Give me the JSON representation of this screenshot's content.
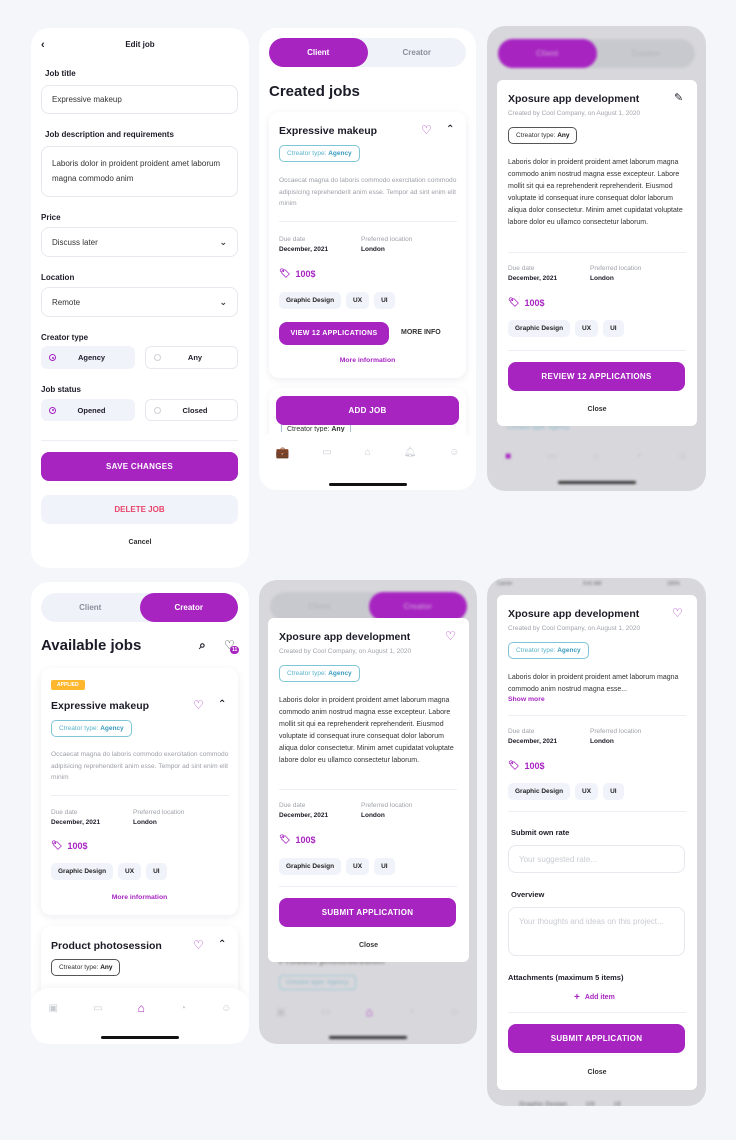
{
  "colors": {
    "accent": "#a724c1",
    "agency": "#5bb4cc",
    "applied": "#ffb82e",
    "danger": "#e8456b"
  },
  "edit_job": {
    "title": "Edit job",
    "job_title_label": "Job title",
    "job_title_value": "Expressive makeup",
    "desc_label": "Job description and requirements",
    "desc_value": "Laboris dolor in proident proident amet laborum magna commodo anim",
    "price_label": "Price",
    "price_value": "Discuss later",
    "location_label": "Location",
    "location_value": "Remote",
    "creator_type_label": "Creator type",
    "creator_type_options": [
      "Agency",
      "Any"
    ],
    "creator_type_selected": "Agency",
    "job_status_label": "Job status",
    "job_status_options": [
      "Opened",
      "Closed"
    ],
    "job_status_selected": "Opened",
    "save_label": "SAVE CHANGES",
    "delete_label": "DELETE JOB",
    "cancel_label": "Cancel"
  },
  "segment": {
    "client": "Client",
    "creator": "Creator"
  },
  "created_jobs": {
    "heading": "Created jobs",
    "card": {
      "title": "Expressive makeup",
      "ctype_prefix": "Ctreator type: ",
      "ctype_value": "Agency",
      "desc": "Occaecat magna do laboris commodo exercitation commodo adipisicing reprehenderit anim esse. Tempor ad sint enim elit minim",
      "due_label": "Due date",
      "due_value": "December, 2021",
      "loc_label": "Preferred location",
      "loc_value": "London",
      "price": "100$",
      "tags": [
        "Graphic Design",
        "UX",
        "UI"
      ],
      "view_apps": "VIEW 12 APPLICATIONS",
      "more_info": "MORE INFO",
      "more_information": "More information"
    },
    "add_job": "ADD JOB",
    "peek_ctype_prefix": "Ctreator type: ",
    "peek_ctype_value": "Any"
  },
  "detail_client": {
    "title": "Xposure app development",
    "created_by": "Created by Cool Company, on August 1, 2020",
    "ctype_prefix": "Ctreator type: ",
    "ctype_value": "Any",
    "desc": "Laboris dolor in proident proident amet laborum magna commodo anim nostrud magna esse excepteur. Labore mollit sit qui ea reprehenderit reprehenderit. Eiusmod voluptate id consequat irure consequat dolor laborum aliqua dolor consectetur. Minim amet cupidatat voluptate labore dolor eu ullamco consectetur laborum.",
    "due_label": "Due date",
    "due_value": "December, 2021",
    "loc_label": "Preferred location",
    "loc_value": "London",
    "price": "100$",
    "tags": [
      "Graphic Design",
      "UX",
      "UI"
    ],
    "review_label": "REVIEW 12 APPLICATIONS",
    "close_label": "Close",
    "bg_ctype": "Ctreator type: Agency"
  },
  "available_jobs": {
    "heading": "Available jobs",
    "favorites_count": "11",
    "card1": {
      "badge": "APPLIED",
      "title": "Expressive makeup",
      "ctype_prefix": "Ctreator type: ",
      "ctype_value": "Agency",
      "desc": "Occaecat magna do laboris commodo exercitation commodo adipisicing reprehenderit anim esse. Tempor ad sint enim elit minim",
      "due_label": "Due date",
      "due_value": "December, 2021",
      "loc_label": "Preferred location",
      "loc_value": "London",
      "price": "100$",
      "tags": [
        "Graphic Design",
        "UX",
        "UI"
      ],
      "more_information": "More information"
    },
    "card2": {
      "title": "Product photosession",
      "ctype_prefix": "Ctreator type: ",
      "ctype_value": "Any"
    }
  },
  "detail_creator": {
    "title": "Xposure app development",
    "created_by": "Created by Cool Company, on August 1, 2020",
    "ctype_prefix": "Ctreator type: ",
    "ctype_value": "Agency",
    "desc": "Laboris dolor in proident proident amet laborum magna commodo anim nostrud magna esse excepteur. Labore mollit sit qui ea reprehenderit reprehenderit. Eiusmod voluptate id consequat irure consequat dolor laborum aliqua dolor consectetur. Minim amet cupidatat voluptate labore dolor eu ullamco consectetur laborum.",
    "due_label": "Due date",
    "due_value": "December, 2021",
    "loc_label": "Preferred location",
    "loc_value": "London",
    "price": "100$",
    "tags": [
      "Graphic Design",
      "UX",
      "UI"
    ],
    "submit_label": "SUBMIT APPLICATION",
    "close_label": "Close",
    "bg_title": "Product photosession",
    "bg_ctype": "Ctreator type: Agency"
  },
  "apply_form": {
    "status_bar": {
      "carrier": "Carrier",
      "time": "9:41 AM",
      "battery": "100%"
    },
    "title": "Xposure app development",
    "created_by": "Created by Cool Company, on August 1, 2020",
    "ctype_prefix": "Ctreator type: ",
    "ctype_value": "Agency",
    "desc_short": "Laboris dolor in proident proident amet laborum magna commodo anim nostrud magna esse...",
    "show_more": "Show more",
    "due_label": "Due date",
    "due_value": "December, 2021",
    "loc_label": "Preferred location",
    "loc_value": "London",
    "price": "100$",
    "tags": [
      "Graphic Design",
      "UX",
      "UI"
    ],
    "rate_label": "Submit own rate",
    "rate_placeholder": "Your suggested rate...",
    "overview_label": "Overview",
    "overview_placeholder": "Your thoughts and ideas on this project...",
    "attachments_label": "Attachments (maximum 5 items)",
    "add_item": "Add item",
    "submit_label": "SUBMIT APPLICATION",
    "close_label": "Close",
    "bg_tags": [
      "Graphic Design",
      "UX",
      "UI"
    ]
  }
}
